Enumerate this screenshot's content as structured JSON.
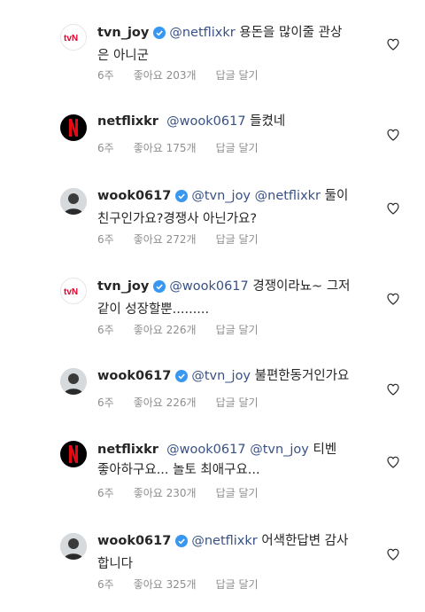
{
  "colors": {
    "mention": "#385185",
    "verified": "#3897f0",
    "meta": "#8e8e8e"
  },
  "comments": [
    {
      "username": "tvn_joy",
      "avatar": "tvn-logo",
      "verified": true,
      "mention": "@netflixkr",
      "text": " 용돈을 많이줄 관상",
      "text2": "은 아니군",
      "time": "6주",
      "likes": "좋아요 203개",
      "reply": "답글 달기"
    },
    {
      "username": "netflixkr",
      "avatar": "netflix-logo",
      "verified": false,
      "mention": "@wook0617",
      "text": " 들켰네",
      "text2": "",
      "time": "6주",
      "likes": "좋아요 175개",
      "reply": "답글 달기"
    },
    {
      "username": "wook0617",
      "avatar": "profile-photo",
      "verified": true,
      "mention": "@tvn_joy",
      "mention2": "@netflixkr",
      "text": " 둘이",
      "text2": "친구인가요?경쟁사 아닌가요?",
      "time": "6주",
      "likes": "좋아요 272개",
      "reply": "답글 달기"
    },
    {
      "username": "tvn_joy",
      "avatar": "tvn-logo",
      "verified": true,
      "mention": "@wook0617",
      "text": " 경쟁이라뇨~ 그저",
      "text2": "같이 성장할뿐.........",
      "time": "6주",
      "likes": "좋아요 226개",
      "reply": "답글 달기"
    },
    {
      "username": "wook0617",
      "avatar": "profile-photo",
      "verified": true,
      "mention": "@tvn_joy",
      "text": " 불편한동거인가요",
      "text2": "",
      "time": "6주",
      "likes": "좋아요 226개",
      "reply": "답글 달기"
    },
    {
      "username": "netflixkr",
      "avatar": "netflix-logo",
      "verified": false,
      "mention": "@wook0617",
      "mention2": "@tvn_joy",
      "text": " 티벤",
      "text2": "좋아하구요... 놀토 최애구요...",
      "time": "6주",
      "likes": "좋아요 230개",
      "reply": "답글 달기"
    },
    {
      "username": "wook0617",
      "avatar": "profile-photo",
      "verified": true,
      "mention": "@netflixkr",
      "text": " 어색한답변 감사",
      "text2": "합니다",
      "time": "6주",
      "likes": "좋아요 325개",
      "reply": "답글 달기"
    }
  ]
}
